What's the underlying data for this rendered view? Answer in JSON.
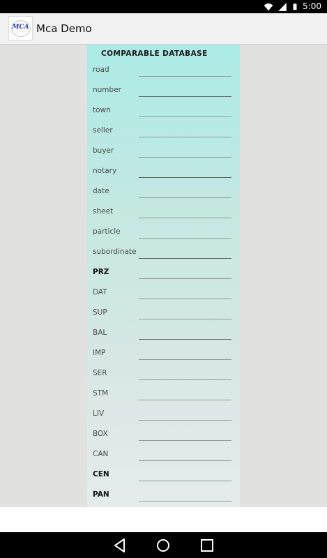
{
  "status_bar": {
    "time": "5:00",
    "icons": [
      "wifi-icon",
      "signal-icon",
      "battery-icon"
    ]
  },
  "action_bar": {
    "logo_text": "MCA",
    "title": "Mca Demo"
  },
  "form": {
    "title": "COMPARABLE DATABASE",
    "fields": [
      {
        "label": "road",
        "value": ""
      },
      {
        "label": "number",
        "value": ""
      },
      {
        "label": "town",
        "value": ""
      },
      {
        "label": "seller",
        "value": ""
      },
      {
        "label": "buyer",
        "value": ""
      },
      {
        "label": "notary",
        "value": ""
      },
      {
        "label": "date",
        "value": ""
      },
      {
        "label": "sheet",
        "value": ""
      },
      {
        "label": "particle",
        "value": ""
      },
      {
        "label": "subordinate",
        "value": ""
      },
      {
        "label": "PRZ",
        "value": ""
      },
      {
        "label": "DAT",
        "value": ""
      },
      {
        "label": "SUP",
        "value": ""
      },
      {
        "label": "BAL",
        "value": ""
      },
      {
        "label": "IMP",
        "value": ""
      },
      {
        "label": "SER",
        "value": ""
      },
      {
        "label": "STM",
        "value": ""
      },
      {
        "label": "LIV",
        "value": ""
      },
      {
        "label": "BOX",
        "value": ""
      },
      {
        "label": "CAN",
        "value": ""
      },
      {
        "label": "CEN",
        "value": ""
      },
      {
        "label": "PAN",
        "value": ""
      }
    ]
  },
  "nav_bar": {
    "buttons": [
      "back-icon",
      "home-icon",
      "recents-icon"
    ]
  },
  "colors": {
    "status_bar": "#000000",
    "action_bar": "#f2f2f2",
    "panel_top": "#acebe6",
    "panel_bottom": "#e5ebeb",
    "nav_bar": "#000000"
  }
}
